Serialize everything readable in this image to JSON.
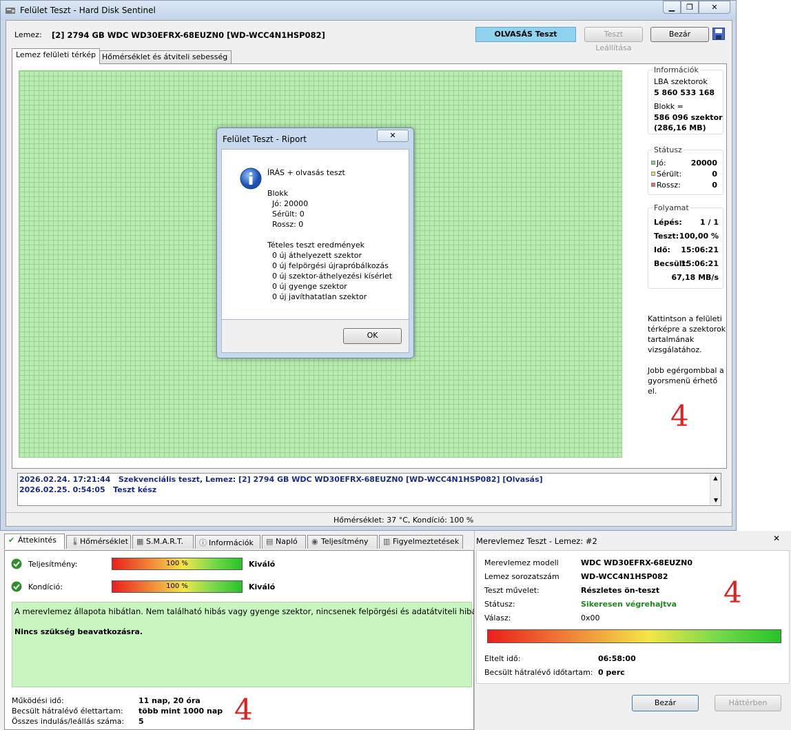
{
  "main_window": {
    "title": "Felület Teszt - Hard Disk Sentinel",
    "disk_label": "Lemez:",
    "disk_value": "[2] 2794 GB  WDC WD30EFRX-68EUZN0 [WD-WCC4N1HSP082]",
    "status_button": "OLVASÁS Teszt",
    "stop_button": "Teszt Leállítása",
    "close_button": "Bezár",
    "tabs": [
      "Lemez felületi térkép",
      "Hőmérséklet és átviteli sebesség"
    ],
    "info": {
      "title": "Információk",
      "lba_label": "LBA szektorok",
      "lba_value": "5 860 533 168",
      "block_label": "Blokk =",
      "block_value": "586 096 szektor",
      "block_mb": "(286,16 MB)"
    },
    "status_group": {
      "title": "Státusz",
      "rows": [
        {
          "label": "Jó:",
          "value": "20000",
          "color": "#7fd67f"
        },
        {
          "label": "Sérült:",
          "value": "0",
          "color": "#e8e070"
        },
        {
          "label": "Rossz:",
          "value": "0",
          "color": "#e06a6a"
        }
      ]
    },
    "progress_group": {
      "title": "Folyamat",
      "rows": [
        {
          "label": "Lépés:",
          "value": "1 / 1"
        },
        {
          "label": "Teszt:",
          "value": "100,00 %"
        },
        {
          "label": "Idő:",
          "value": "15:06:21"
        },
        {
          "label": "Becsült:",
          "value": "15:06:21"
        }
      ],
      "speed": "67,18 MB/s"
    },
    "help1": "Kattintson a felületi térképre a szektorok tartalmának vizsgálatához.",
    "help2": "Jobb egérgombbal a gyorsmenü érhető el.",
    "log": [
      {
        "date": "2026.02.24.  17:21:44",
        "text": "Szekvenciális teszt, Lemez: [2] 2794 GB  WDC WD30EFRX-68EUZN0 [WD-WCC4N1HSP082] [Olvasás]"
      },
      {
        "date": "2026.02.25.  0:54:05",
        "text": "Teszt kész"
      }
    ],
    "statusbar": "Hőmérséklet: 37  °C,  Kondíció: 100 %"
  },
  "dialog": {
    "title": "Felület Teszt - Riport",
    "lines": [
      "ÍRÁS + olvasás teszt",
      "",
      "Blokk",
      "  Jó: 20000",
      "  Sérült: 0",
      "  Rossz: 0",
      "",
      "Tételes teszt eredmények",
      "  0 új áthelyezett szektor",
      "  0 új felpörgési újrapróbálkozás",
      "  0 új szektor-áthelyezési kísérlet",
      "  0 új gyenge szektor",
      "  0 új javíthatatlan szektor"
    ],
    "ok": "OK"
  },
  "overview": {
    "tabs": [
      "Áttekintés",
      "Hőmérséklet",
      "S.M.A.R.T.",
      "Információk",
      "Napló",
      "Teljesítmény",
      "Figyelmeztetések"
    ],
    "performance_label": "Teljesítmény:",
    "performance_value": 100,
    "performance_text": "100 %",
    "performance_rating": "Kiváló",
    "health_label": "Kondíció:",
    "health_value": 100,
    "health_text": "100 %",
    "health_rating": "Kiváló",
    "message1": "A merevlemez állapota hibátlan. Nem található hibás vagy gyenge szektor, nincsenek felpörgési és adatátviteli hibák sem.",
    "message2": "Nincs szükség beavatkozásra.",
    "stats": [
      {
        "label": "Működési idő:",
        "value": "11 nap, 20 óra"
      },
      {
        "label": "Becsült hátralévő élettartam:",
        "value": "több mint 1000 nap"
      },
      {
        "label": "Összes indulás/leállás száma:",
        "value": "5"
      }
    ]
  },
  "selftest": {
    "title": "Merevlemez Teszt - Lemez: #2",
    "rows": [
      {
        "label": "Merevlemez modell",
        "value": "WDC WD30EFRX-68EUZN0"
      },
      {
        "label": "Lemez sorozatszám",
        "value": "WD-WCC4N1HSP082"
      },
      {
        "label": "Teszt művelet:",
        "value": "Részletes ön-teszt"
      },
      {
        "label": "Státusz:",
        "value": "Sikeresen végrehajtva"
      },
      {
        "label": "Válasz:",
        "value": "0x00"
      }
    ],
    "progress": 100,
    "elapsed_label": "Eltelt idő:",
    "elapsed_value": "06:58:00",
    "remaining_label": "Becsült hátralévő időtartam:",
    "remaining_value": "0 perc",
    "close": "Bezár",
    "background": "Háttérben",
    "success_color": "#1a8c1a"
  },
  "marks": {
    "mark1": "4",
    "mark2": "4",
    "mark3": "4"
  }
}
